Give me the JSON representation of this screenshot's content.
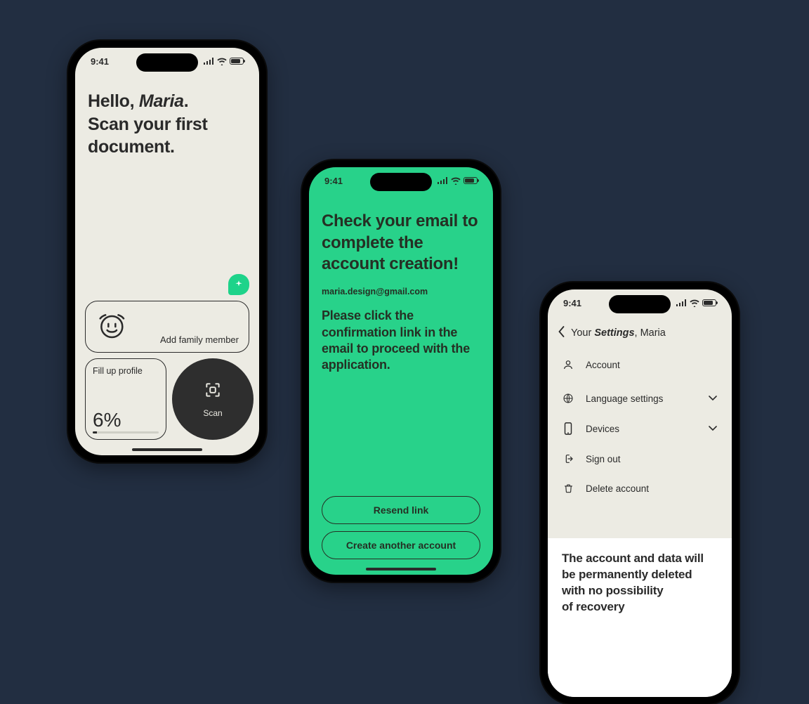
{
  "statusTime": "9:41",
  "screen1": {
    "greeting_pre": "Hello, ",
    "greeting_name": "Maria",
    "greeting_post": ".",
    "headline_l2": "Scan your first",
    "headline_l3": "document.",
    "familyCardLabel": "Add family member",
    "profileTitle": "Fill up profile",
    "profilePercentText": "6%",
    "profilePercentValue": 6,
    "scanLabel": "Scan"
  },
  "screen2": {
    "headline": "Check your email to complete the account creation!",
    "email": "maria.design@gmail.com",
    "sub": "Please click the confirmation link in the email to proceed with the application.",
    "resend": "Resend link",
    "createAnother": "Create another account"
  },
  "screen3": {
    "title_pre": "Your ",
    "title_em": "Settings",
    "title_post": ", Maria",
    "items": {
      "account": "Account",
      "language": "Language settings",
      "devices": "Devices",
      "signout": "Sign out",
      "delete": "Delete account"
    },
    "warn_l1": "The account and data will",
    "warn_l2": "be permanently deleted",
    "warn_l3": "with no possibility",
    "warn_l4": "of recovery"
  }
}
